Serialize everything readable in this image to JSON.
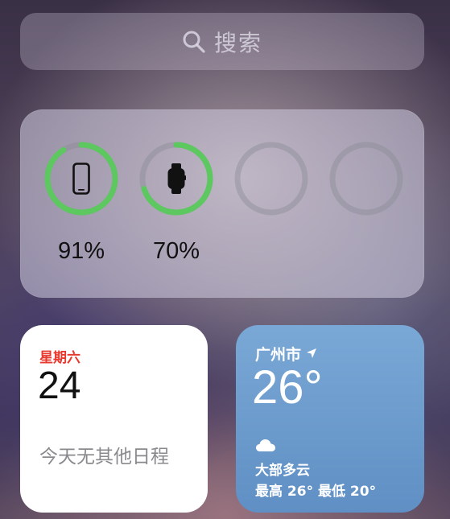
{
  "search": {
    "placeholder": "搜索",
    "icon": "search-icon"
  },
  "batteries": {
    "accent_color": "#5cc85f",
    "devices": [
      {
        "name": "iPhone",
        "icon": "iphone-icon",
        "level": 91,
        "label": "91%"
      },
      {
        "name": "Apple Watch",
        "icon": "watch-icon",
        "level": 70,
        "label": "70%"
      },
      {
        "name": "",
        "icon": "",
        "level": 0,
        "label": ""
      },
      {
        "name": "",
        "icon": "",
        "level": 0,
        "label": ""
      }
    ]
  },
  "calendar": {
    "weekday": "星期六",
    "day": "24",
    "empty_text": "今天无其他日程",
    "accent_color": "#e8392f"
  },
  "weather": {
    "city": "广州市",
    "location_icon": "location-arrow-icon",
    "temperature": "26°",
    "condition_icon": "cloud-icon",
    "condition": "大部多云",
    "range": "最高 26° 最低 20°"
  }
}
